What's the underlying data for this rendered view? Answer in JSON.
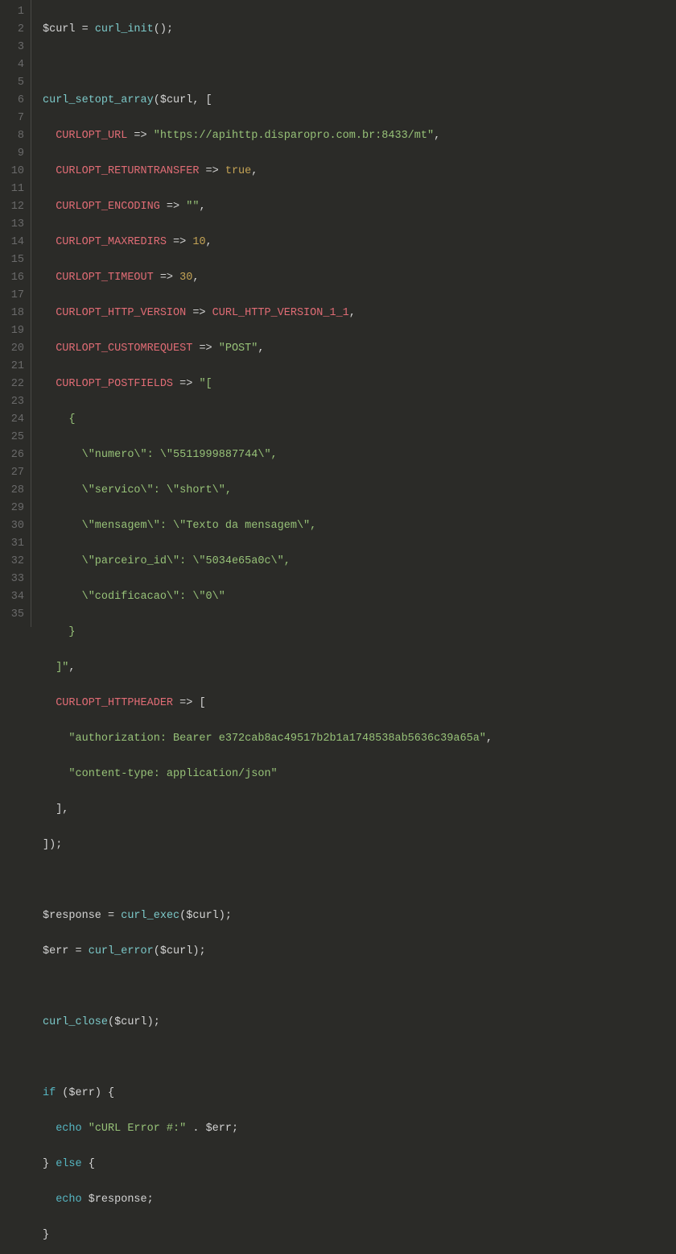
{
  "lines": {
    "l1": {
      "var": "$curl",
      "eq": " = ",
      "fn": "curl_init",
      "p": "();"
    },
    "l3": {
      "fn": "curl_setopt_array",
      "p1": "(",
      "var": "$curl",
      "p2": ", ["
    },
    "l4": {
      "k": "CURLOPT_URL",
      "a": " => ",
      "s": "\"https://apihttp.disparopro.com.br:8433/mt\"",
      "p": ","
    },
    "l5": {
      "k": "CURLOPT_RETURNTRANSFER",
      "a": " => ",
      "b": "true",
      "p": ","
    },
    "l6": {
      "k": "CURLOPT_ENCODING",
      "a": " => ",
      "s": "\"\"",
      "p": ","
    },
    "l7": {
      "k": "CURLOPT_MAXREDIRS",
      "a": " => ",
      "n": "10",
      "p": ","
    },
    "l8": {
      "k": "CURLOPT_TIMEOUT",
      "a": " => ",
      "n": "30",
      "p": ","
    },
    "l9": {
      "k": "CURLOPT_HTTP_VERSION",
      "a": " => ",
      "c": "CURL_HTTP_VERSION_1_1",
      "p": ","
    },
    "l10": {
      "k": "CURLOPT_CUSTOMREQUEST",
      "a": " => ",
      "s": "\"POST\"",
      "p": ","
    },
    "l11": {
      "k": "CURLOPT_POSTFIELDS",
      "a": " => ",
      "s": "\"["
    },
    "l12": {
      "s": "    {"
    },
    "l13": {
      "s": "      \\\"numero\\\": \\\"5511999887744\\\","
    },
    "l14": {
      "s": "      \\\"servico\\\": \\\"short\\\","
    },
    "l15": {
      "s": "      \\\"mensagem\\\": \\\"Texto da mensagem\\\","
    },
    "l16": {
      "s": "      \\\"parceiro_id\\\": \\\"5034e65a0c\\\","
    },
    "l17": {
      "s": "      \\\"codificacao\\\": \\\"0\\\""
    },
    "l18": {
      "s": "    }"
    },
    "l19": {
      "s": "  ]\"",
      "p": ","
    },
    "l20": {
      "k": "CURLOPT_HTTPHEADER",
      "a": " => ",
      "p": "["
    },
    "l21": {
      "s": "\"authorization: Bearer e372cab8ac49517b2b1a1748538ab5636c39a65a\"",
      "p": ","
    },
    "l22": {
      "s": "\"content-type: application/json\""
    },
    "l23": {
      "p": "],"
    },
    "l24": {
      "p": "]);"
    },
    "l26": {
      "var": "$response",
      "eq": " = ",
      "fn": "curl_exec",
      "p1": "(",
      "arg": "$curl",
      "p2": ");"
    },
    "l27": {
      "var": "$err",
      "eq": " = ",
      "fn": "curl_error",
      "p1": "(",
      "arg": "$curl",
      "p2": ");"
    },
    "l29": {
      "fn": "curl_close",
      "p1": "(",
      "arg": "$curl",
      "p2": ");"
    },
    "l31": {
      "kw": "if",
      "p1": " (",
      "var": "$err",
      "p2": ") {"
    },
    "l32": {
      "kw": "echo",
      "sp": " ",
      "s": "\"cURL Error #:\"",
      "dot": " . ",
      "var": "$err",
      "p": ";"
    },
    "l33": {
      "p1": "} ",
      "kw": "else",
      "p2": " {"
    },
    "l34": {
      "kw": "echo",
      "sp": " ",
      "var": "$response",
      "p": ";"
    },
    "l35": {
      "p": "}"
    }
  },
  "gutter": [
    "1",
    "2",
    "3",
    "4",
    "5",
    "6",
    "7",
    "8",
    "9",
    "10",
    "11",
    "12",
    "13",
    "14",
    "15",
    "16",
    "17",
    "18",
    "19",
    "20",
    "21",
    "22",
    "23",
    "24",
    "25",
    "26",
    "27",
    "28",
    "29",
    "30",
    "31",
    "32",
    "33",
    "34",
    "35"
  ]
}
